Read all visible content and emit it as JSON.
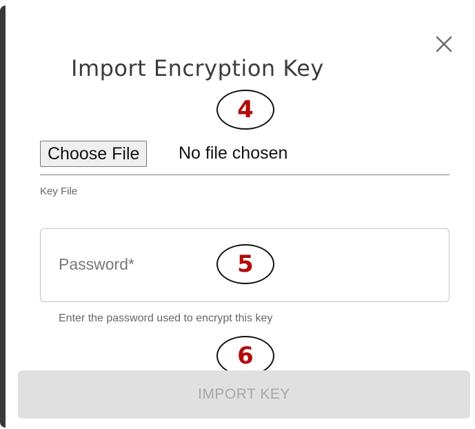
{
  "dialog": {
    "title": "Import Encryption Key",
    "close_icon": "close-icon"
  },
  "annotations": {
    "step_file": "4",
    "step_password": "5",
    "step_import": "6",
    "color": "#b30a0a"
  },
  "key_file": {
    "button_label": "Choose File",
    "status": "No file chosen",
    "label": "Key File"
  },
  "password": {
    "placeholder": "Password*",
    "helper": "Enter the password used to encrypt this key"
  },
  "actions": {
    "import_label": "IMPORT KEY",
    "enabled": false
  }
}
